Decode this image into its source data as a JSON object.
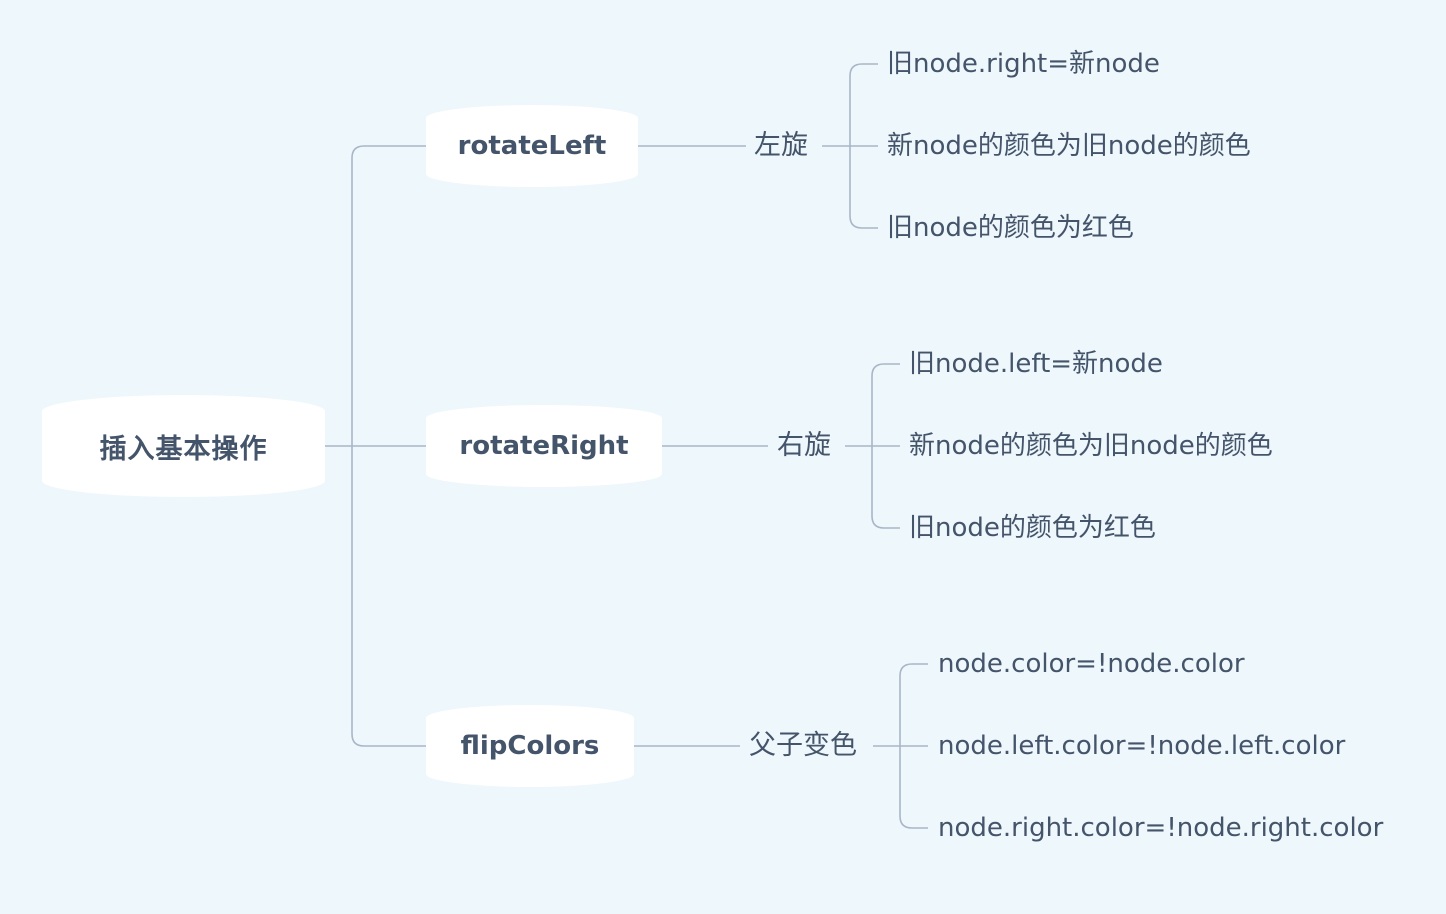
{
  "root": {
    "label": "插入基本操作"
  },
  "branches": [
    {
      "label": "rotateLeft",
      "sub": "左旋",
      "leaves": [
        "旧node.right=新node",
        "新node的颜色为旧node的颜色",
        "旧node的颜色为红色"
      ]
    },
    {
      "label": "rotateRight",
      "sub": "右旋",
      "leaves": [
        "旧node.left=新node",
        "新node的颜色为旧node的颜色",
        "旧node的颜色为红色"
      ]
    },
    {
      "label": "flipColors",
      "sub": "父子变色",
      "leaves": [
        "node.color=!node.color",
        "node.left.color=!node.left.color",
        "node.right.color=!node.right.color"
      ]
    }
  ],
  "colors": {
    "background": "#eef7fb",
    "line": "#a9b6c8",
    "text": "#44546a",
    "node_fill": "#ffffff"
  }
}
